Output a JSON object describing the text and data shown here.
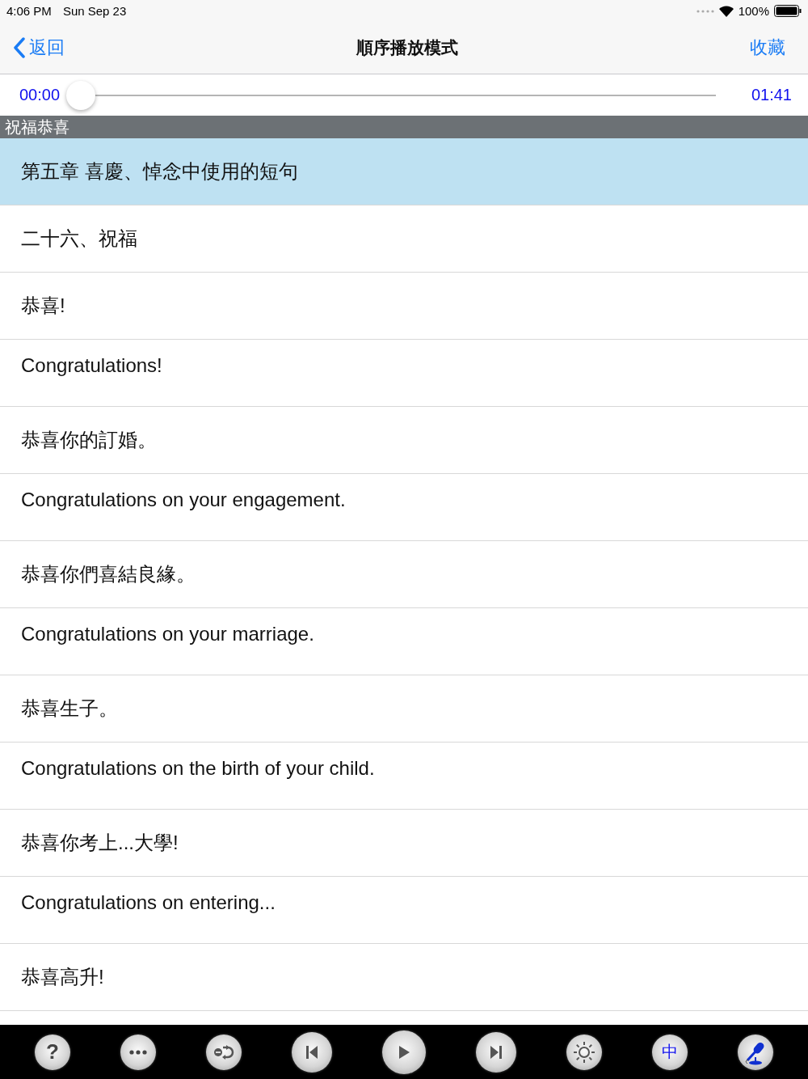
{
  "status_bar": {
    "time": "4:06 PM",
    "date": "Sun Sep 23",
    "battery": "100%"
  },
  "nav": {
    "back": "返回",
    "title": "順序播放模式",
    "action": "收藏"
  },
  "player": {
    "elapsed": "00:00",
    "level": 0,
    "total": "01:41"
  },
  "section": {
    "title": "祝福恭喜"
  },
  "rows": [
    {
      "text": "第五章  喜慶、悼念中使用的短句",
      "kind": "zh",
      "selected": true
    },
    {
      "text": "二十六、祝福",
      "kind": "zh",
      "selected": false
    },
    {
      "text": "恭喜!",
      "kind": "zh",
      "selected": false
    },
    {
      "text": "Congratulations!",
      "kind": "en",
      "selected": false
    },
    {
      "text": "恭喜你的訂婚。",
      "kind": "zh",
      "selected": false
    },
    {
      "text": "Congratulations on your engagement.",
      "kind": "en",
      "selected": false
    },
    {
      "text": "恭喜你們喜結良緣。",
      "kind": "zh",
      "selected": false
    },
    {
      "text": "Congratulations on your marriage.",
      "kind": "en",
      "selected": false
    },
    {
      "text": "恭喜生子。",
      "kind": "zh",
      "selected": false
    },
    {
      "text": "Congratulations on the birth of your child.",
      "kind": "en",
      "selected": false
    },
    {
      "text": "恭喜你考上...大學!",
      "kind": "zh",
      "selected": false
    },
    {
      "text": "Congratulations on entering...",
      "kind": "en",
      "selected": false
    },
    {
      "text": "恭喜高升!",
      "kind": "zh",
      "selected": false
    }
  ],
  "toolbar": [
    {
      "kind": "help",
      "label": "?"
    },
    {
      "kind": "more"
    },
    {
      "kind": "repeat"
    },
    {
      "kind": "previous"
    },
    {
      "kind": "play"
    },
    {
      "kind": "next"
    },
    {
      "kind": "brightness"
    },
    {
      "kind": "language",
      "label": "中"
    },
    {
      "kind": "microphone"
    }
  ]
}
